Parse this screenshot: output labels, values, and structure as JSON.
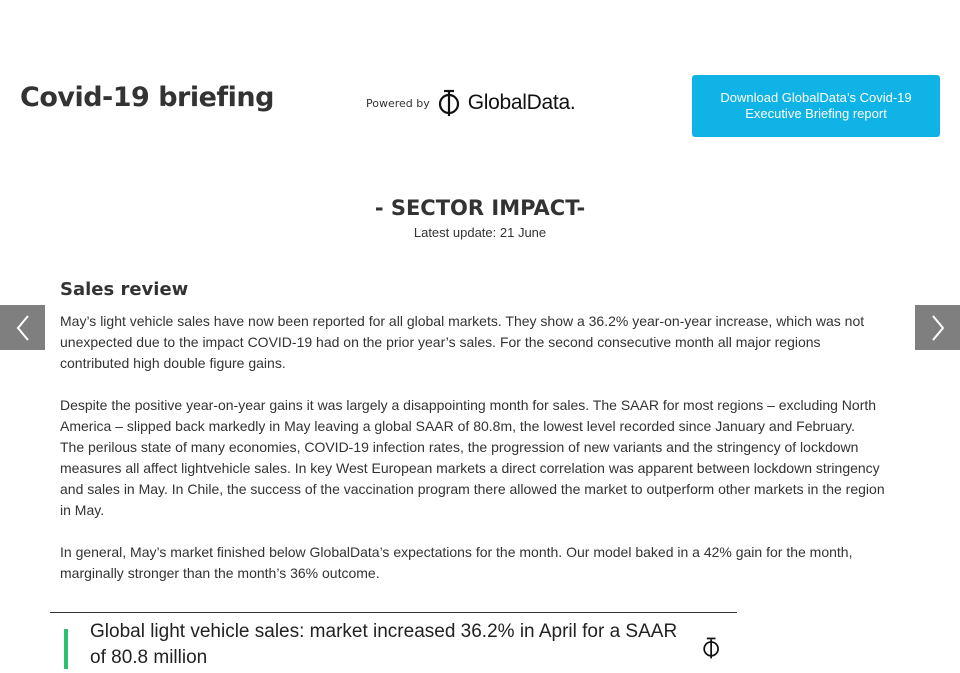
{
  "header": {
    "title": "Covid-19 briefing",
    "powered_by": "Powered by",
    "logo_text": "GlobalData.",
    "download_label": "Download GlobalData’s Covid-19 Executive Briefing report"
  },
  "section": {
    "heading": "- SECTOR IMPACT-",
    "update": "Latest update: 21 June"
  },
  "article": {
    "subhead": "Sales review",
    "paragraphs": [
      "May’s light vehicle sales have now been reported for all global markets. They show a 36.2% year-on-year increase, which was not unexpected due to the impact COVID-19 had on the prior year’s sales. For the second consecutive month all major regions contributed high double figure gains.",
      "Despite the positive year-on-year gains it was largely a disappointing month for sales. The SAAR for most regions – excluding North America – slipped back markedly in May leaving a global SAAR of 80.8m, the lowest level recorded since January and February.",
      "The perilous state of many economies, COVID-19 infection rates, the progression of new variants and the stringency of lockdown measures all affect lightvehicle sales. In key West European markets a direct correlation was apparent between lockdown stringency and sales in May. In Chile, the success of the vaccination program there allowed the market to outperform other markets in the region in May.",
      "In general, May’s market finished below GlobalData’s expectations for the month. Our model baked in a 42% gain for the month, marginally stronger than the month’s 36% outcome."
    ]
  },
  "chart_preview": {
    "title": "Global light vehicle sales: market increased 36.2% in April for a SAAR of 80.8 million"
  },
  "icons": {
    "prev": "chevron-left-icon",
    "next": "chevron-right-icon",
    "logo": "globaldata-logo-icon"
  },
  "colors": {
    "accent": "#0fb3e6",
    "nav_arrow_bg": "#7f7f7f",
    "chart_accent": "#2dbf72"
  }
}
